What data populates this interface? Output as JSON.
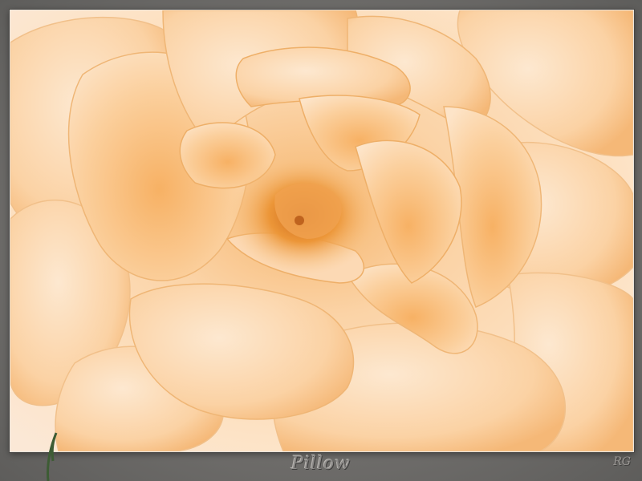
{
  "image": {
    "subject": "rose-flower",
    "colors": {
      "petal_light": "#fde6cc",
      "petal_mid": "#f9cf9d",
      "petal_deep": "#f2a85a",
      "center": "#e88a2a",
      "frame": "#6f6f6d"
    }
  },
  "caption": {
    "text": "Pillow"
  },
  "signature": {
    "text": "RG"
  }
}
